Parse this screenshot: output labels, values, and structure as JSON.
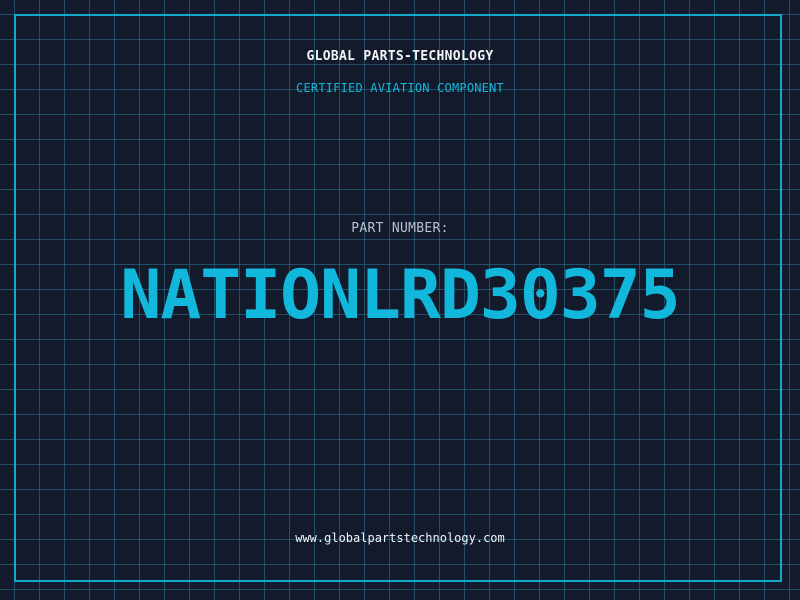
{
  "header": {
    "company": "GLOBAL PARTS-TECHNOLOGY",
    "tagline": "CERTIFIED AVIATION COMPONENT"
  },
  "part": {
    "label": "PART NUMBER:",
    "number": "NATIONLRD30375"
  },
  "footer": {
    "website": "www.globalpartstechnology.com"
  },
  "colors": {
    "background": "#131a2c",
    "accent": "#12b7dc",
    "grid": "#287896",
    "text": "#f2f4f7"
  }
}
